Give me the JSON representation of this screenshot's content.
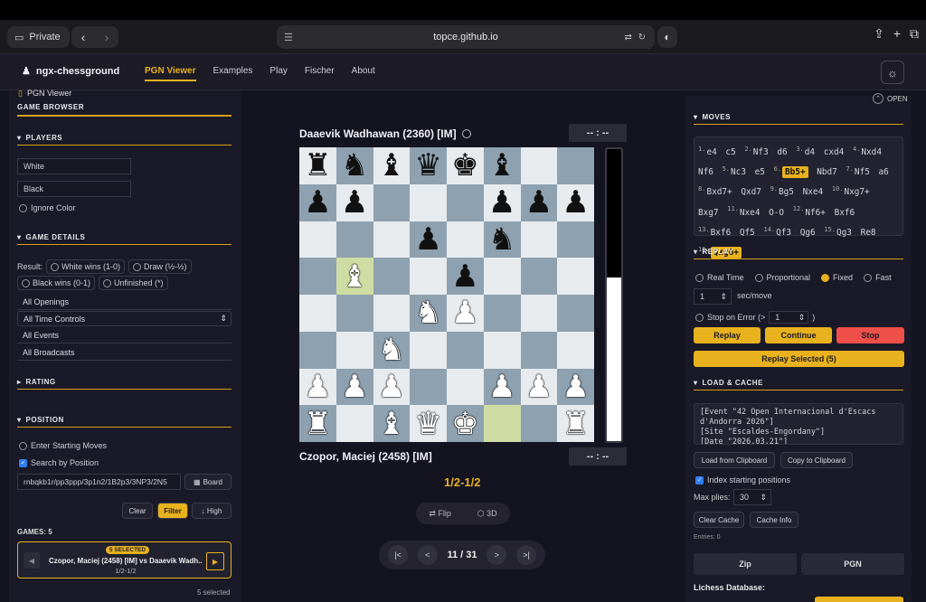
{
  "browser": {
    "private_label": "Private",
    "url": "topce.github.io"
  },
  "app": {
    "brand": "ngx-chessground",
    "nav": [
      "PGN Viewer",
      "Examples",
      "Play",
      "Fischer",
      "About"
    ]
  },
  "left": {
    "breadcrumb": "PGN Viewer",
    "game_browser": "GAME BROWSER",
    "players": {
      "title": "PLAYERS",
      "white_placeholder": "White",
      "black_placeholder": "Black",
      "ignore_color": "Ignore Color"
    },
    "game_details": {
      "title": "GAME DETAILS",
      "result_label": "Result:",
      "white_wins": "White wins (1-0)",
      "draw": "Draw (½-½)",
      "black_wins": "Black wins (0-1)",
      "unfinished": "Unfinished (*)",
      "selects": [
        "All Openings",
        "All Time Controls",
        "All Events",
        "All Broadcasts"
      ]
    },
    "rating": {
      "title": "RATING"
    },
    "position": {
      "title": "POSITION",
      "enter_moves": "Enter Starting Moves",
      "search_by_position": "Search by Position",
      "fen": "rnbqkb1r/pp3ppp/3p1n2/1B2p3/3NP3/2N5",
      "board_btn": "Board",
      "clear_btn": "Clear",
      "filter_btn": "Filter",
      "high_btn": "↓ High"
    },
    "games_count": "GAMES: 5",
    "game_card": {
      "badge": "5 SELECTED",
      "title": "Czopor, Maciej (2458) [IM] vs Daaevik Wadh...",
      "result": "1/2-1/2"
    },
    "selected_footer": "5 selected"
  },
  "board": {
    "top_player": "Daaevik Wadhawan (2360) [IM]",
    "bottom_player": "Czopor, Maciej (2458) [IM]",
    "top_clock": "-- : --",
    "bottom_clock": "-- : --",
    "result": "1/2-1/2",
    "flip": "Flip",
    "threeD": "3D",
    "page": "11 / 31",
    "eval_black_fraction": 0.44,
    "rows": [
      [
        "r",
        "n",
        "b",
        "q",
        "k",
        "b",
        "",
        ""
      ],
      [
        "p",
        "p",
        "",
        "",
        "",
        "p",
        "p",
        "p"
      ],
      [
        "",
        "",
        "",
        "p",
        "",
        "n",
        "",
        ""
      ],
      [
        "",
        "B",
        "",
        "",
        "p",
        "",
        "",
        ""
      ],
      [
        "",
        "",
        "",
        "N",
        "P",
        "",
        "",
        ""
      ],
      [
        "",
        "",
        "N",
        "",
        "",
        "",
        "",
        ""
      ],
      [
        "P",
        "P",
        "P",
        "",
        "",
        "P",
        "P",
        "P"
      ],
      [
        "R",
        "",
        "B",
        "Q",
        "K",
        "",
        "",
        "R"
      ]
    ],
    "highlights": [
      [
        3,
        1
      ],
      [
        7,
        5
      ]
    ]
  },
  "right": {
    "open": "OPEN",
    "moves_title": "MOVES",
    "moves": [
      {
        "n": "1.",
        "w": "e4",
        "b": "c5"
      },
      {
        "n": "2.",
        "w": "Nf3",
        "b": "d6"
      },
      {
        "n": "3.",
        "w": "d4",
        "b": "cxd4"
      },
      {
        "n": "4.",
        "w": "Nxd4",
        "b": "Nf6"
      },
      {
        "n": "5.",
        "w": "Nc3",
        "b": "e5"
      },
      {
        "n": "6.",
        "w": "Bb5+",
        "b": "Nbd7"
      },
      {
        "n": "7.",
        "w": "Nf5",
        "b": "a6"
      },
      {
        "n": "8.",
        "w": "Bxd7+",
        "b": "Qxd7"
      },
      {
        "n": "9.",
        "w": "Bg5",
        "b": "Nxe4"
      },
      {
        "n": "10.",
        "w": "Nxg7+",
        "b": "Bxg7"
      },
      {
        "n": "11.",
        "w": "Nxe4",
        "b": "O-O"
      },
      {
        "n": "12.",
        "w": "Nf6+",
        "b": "Bxf6"
      },
      {
        "n": "13.",
        "w": "Bxf6",
        "b": "Qf5"
      },
      {
        "n": "14.",
        "w": "Qf3",
        "b": "Qg6"
      },
      {
        "n": "15.",
        "w": "Qg3",
        "b": "Re8"
      },
      {
        "n": "16.",
        "w": "Qxg6+",
        "b": ""
      }
    ],
    "replay_title": "REPLAY",
    "modes": [
      "Real Time",
      "Proportional",
      "Fixed",
      "Fast"
    ],
    "sec_value": "1",
    "sec_label": "sec/move",
    "stop_on_error": "Stop on Error (>",
    "stop_value": "1",
    "stop_close": ")",
    "replay_btn": "Replay",
    "continue_btn": "Continue",
    "stop_btn": "Stop",
    "replay_selected_btn": "Replay Selected (5)",
    "load_title": "LOAD & CACHE",
    "pgn_lines": [
      "[Event \"42 Open Internacional d'Escacs",
      "d'Andorra 2026\"]",
      "[Site \"Escaldes-Engordany\"]",
      "[Date \"2026.03.21\"]"
    ],
    "load_clipboard": "Load from Clipboard",
    "copy_clipboard": "Copy to Clipboard",
    "index_positions": "Index starting positions",
    "max_plies_label": "Max plies:",
    "max_plies_value": "30",
    "clear_cache": "Clear Cache",
    "cache_info": "Cache Info",
    "entries": "Entries: 0",
    "zip": "Zip",
    "pgn": "PGN",
    "lichess_db": "Lichess Database:"
  },
  "colors": {
    "accent": "#e8b21f",
    "stop": "#f0504a",
    "bg": "#141320",
    "panel": "#1a1927"
  }
}
